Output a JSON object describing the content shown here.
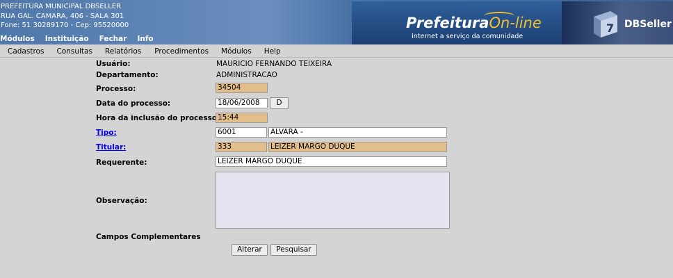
{
  "header": {
    "line1": "PREFEITURA MUNICIPAL DBSELLER",
    "line2": "RUA GAL. CAMARA, 406 - SALA 301",
    "line3": "Fone: 51 30289170  -  Cep: 95520000",
    "top_menu": [
      "Módulos",
      "Instituição",
      "Fechar",
      "Info"
    ],
    "logo_prefix": "Prefeitura",
    "logo_suffix": "On-line",
    "logo_tagline": "Internet a serviço da comunidade",
    "brand": "DBSeller"
  },
  "menu": [
    "Cadastros",
    "Consultas",
    "Relatórios",
    "Procedimentos",
    "Módulos",
    "Help"
  ],
  "form": {
    "usuario_label": "Usuário:",
    "usuario_value": "MAURICIO FERNANDO TEIXEIRA",
    "departamento_label": "Departamento:",
    "departamento_value": "ADMINISTRACAO",
    "processo_label": "Processo:",
    "processo_value": "34504",
    "data_label": "Data do processo:",
    "data_value": "18/06/2008",
    "data_button": "D",
    "hora_label": "Hora da inclusão do processo:",
    "hora_value": "15:44",
    "tipo_label": "Tipo:",
    "tipo_code": "6001",
    "tipo_desc": "ALVARA -",
    "titular_label": "Titular:",
    "titular_code": "333",
    "titular_name": "LEIZER MARGO DUQUE",
    "requerente_label": "Requerente:",
    "requerente_value": "LEIZER MARGO DUQUE",
    "observacao_label": "Observação:",
    "campos_label": "Campos Complementares",
    "alterar_button": "Alterar",
    "pesquisar_button": "Pesquisar"
  },
  "colors": {
    "header_blue": "#4f77aa",
    "readonly_field": "#e3be8d",
    "textarea_bg": "#e6e4f0",
    "background": "#d4d4d4"
  }
}
